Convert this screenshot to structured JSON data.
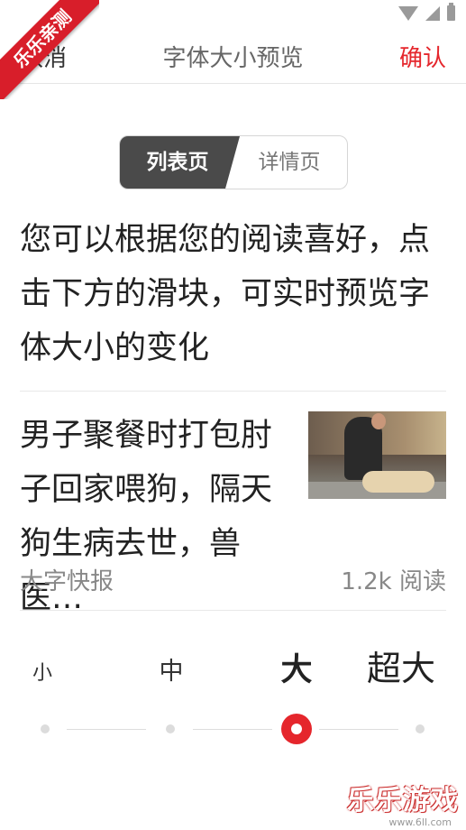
{
  "ribbon": {
    "text": "乐乐亲测"
  },
  "header": {
    "cancel": "取消",
    "title": "字体大小预览",
    "confirm": "确认"
  },
  "tabs": [
    {
      "label": "列表页",
      "active": true
    },
    {
      "label": "详情页",
      "active": false
    }
  ],
  "intro": "您可以根据您的阅读喜好，点击下方的滑块，可实时预览字体大小的变化",
  "news": {
    "title": "男子聚餐时打包肘子回家喂狗，隔天狗生病去世，兽医…",
    "source": "大字快报",
    "reads": "1.2k 阅读"
  },
  "font_sizes": [
    "小",
    "中",
    "大",
    "超大"
  ],
  "selected_size": "大",
  "watermark": {
    "text": "乐乐游戏",
    "url": "www.6ll.com"
  },
  "colors": {
    "accent": "#e5262c",
    "segment_active": "#4a4a4a",
    "ribbon": "#d81e2a"
  },
  "icons": [
    "wifi-icon",
    "signal-icon",
    "battery-icon"
  ]
}
